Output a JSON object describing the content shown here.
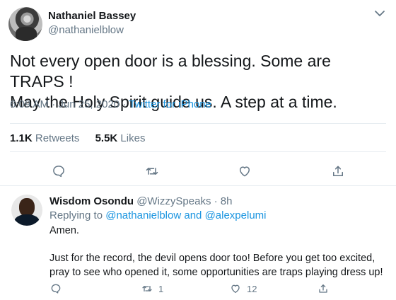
{
  "tweet": {
    "author_name": "Nathaniel Bassey",
    "author_handle": "@nathanielblow",
    "text_line1": "Not every open door is a blessing. Some are TRAPS !",
    "text_line2": "May the Holy Spirit guide us. A step at a time.",
    "time": "6:09 AM",
    "separator": "·",
    "date": "Jun 25, 2020",
    "source": "Twitter for iPhone",
    "retweets_count": "1.1K",
    "retweets_label": "Retweets",
    "likes_count": "5.5K",
    "likes_label": "Likes"
  },
  "reply": {
    "author_name": "Wisdom Osondu",
    "author_handle": "@WizzySpeaks",
    "dot": "·",
    "age": "8h",
    "replying_prefix": "Replying to",
    "mention1": "@nathanielblow",
    "and_word": "and",
    "mention2": "@alexpelumi",
    "line_amen": "Amen.",
    "body_line1": "Just for the record, the devil opens door too! Before you get too excited,",
    "body_line2": "pray to see who opened it, some opportunities are traps playing dress up!",
    "retweet_count": "1",
    "like_count": "12"
  },
  "icons": {
    "more": "chevron-down-icon",
    "reply": "comment-icon",
    "retweet": "retweet-icon",
    "like": "heart-icon",
    "share": "share-icon"
  },
  "colors": {
    "link": "#1b95e0",
    "secondary_text": "#657786",
    "primary_text": "#14171a",
    "divider": "#e6ecf0"
  }
}
